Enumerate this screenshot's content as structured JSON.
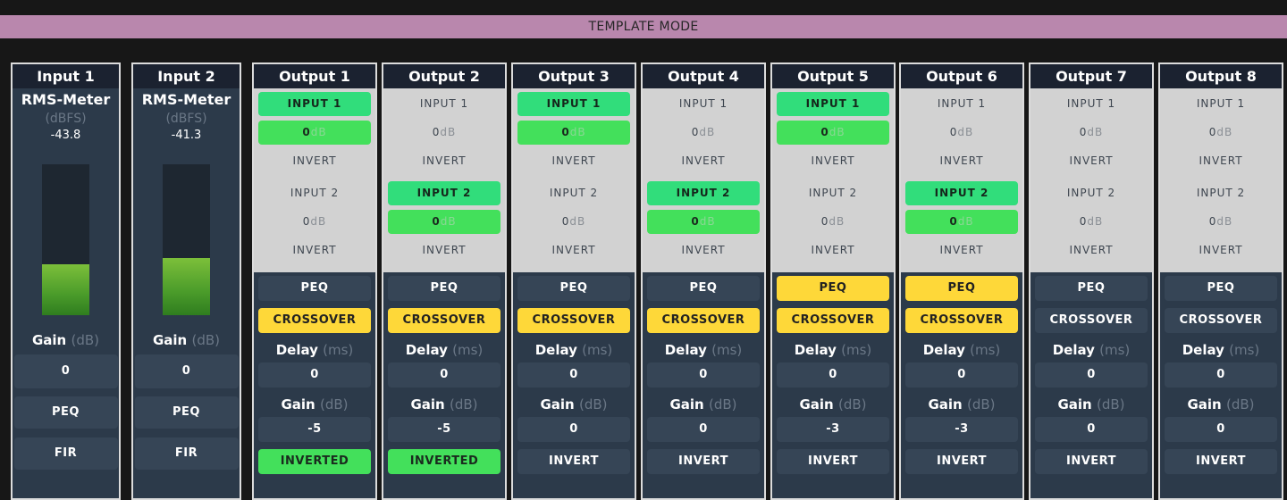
{
  "banner": "TEMPLATE MODE",
  "inputs": [
    {
      "title": "Input 1",
      "rms_label": "RMS-Meter",
      "rms_unit": "(dBFS)",
      "rms_value": "-43.8",
      "meter_level": 0.34,
      "gain_label": "Gain",
      "gain_unit": "(dB)",
      "gain_value": "0",
      "peq": "PEQ",
      "fir": "FIR"
    },
    {
      "title": "Input 2",
      "rms_label": "RMS-Meter",
      "rms_unit": "(dBFS)",
      "rms_value": "-41.3",
      "meter_level": 0.38,
      "gain_label": "Gain",
      "gain_unit": "(dB)",
      "gain_value": "0",
      "peq": "PEQ",
      "fir": "FIR"
    }
  ],
  "outputs": [
    {
      "title": "Output 1",
      "in1": "INPUT 1",
      "in1_on": true,
      "db1": "0",
      "db1_on": true,
      "inv1": "INVERT",
      "in2": "INPUT 2",
      "in2_on": false,
      "db2": "0",
      "db2_on": false,
      "inv2": "INVERT",
      "peq": "PEQ",
      "peq_on": false,
      "crossover": "CROSSOVER",
      "crossover_on": true,
      "delay_label": "Delay",
      "delay_unit": "(ms)",
      "delay_value": "0",
      "gain_label": "Gain",
      "gain_unit": "(dB)",
      "gain_value": "-5",
      "invert": "INVERTED",
      "invert_on": true
    },
    {
      "title": "Output 2",
      "in1": "INPUT 1",
      "in1_on": false,
      "db1": "0",
      "db1_on": false,
      "inv1": "INVERT",
      "in2": "INPUT 2",
      "in2_on": true,
      "db2": "0",
      "db2_on": true,
      "inv2": "INVERT",
      "peq": "PEQ",
      "peq_on": false,
      "crossover": "CROSSOVER",
      "crossover_on": true,
      "delay_label": "Delay",
      "delay_unit": "(ms)",
      "delay_value": "0",
      "gain_label": "Gain",
      "gain_unit": "(dB)",
      "gain_value": "-5",
      "invert": "INVERTED",
      "invert_on": true
    },
    {
      "title": "Output 3",
      "in1": "INPUT 1",
      "in1_on": true,
      "db1": "0",
      "db1_on": true,
      "inv1": "INVERT",
      "in2": "INPUT 2",
      "in2_on": false,
      "db2": "0",
      "db2_on": false,
      "inv2": "INVERT",
      "peq": "PEQ",
      "peq_on": false,
      "crossover": "CROSSOVER",
      "crossover_on": true,
      "delay_label": "Delay",
      "delay_unit": "(ms)",
      "delay_value": "0",
      "gain_label": "Gain",
      "gain_unit": "(dB)",
      "gain_value": "0",
      "invert": "INVERT",
      "invert_on": false
    },
    {
      "title": "Output 4",
      "in1": "INPUT 1",
      "in1_on": false,
      "db1": "0",
      "db1_on": false,
      "inv1": "INVERT",
      "in2": "INPUT 2",
      "in2_on": true,
      "db2": "0",
      "db2_on": true,
      "inv2": "INVERT",
      "peq": "PEQ",
      "peq_on": false,
      "crossover": "CROSSOVER",
      "crossover_on": true,
      "delay_label": "Delay",
      "delay_unit": "(ms)",
      "delay_value": "0",
      "gain_label": "Gain",
      "gain_unit": "(dB)",
      "gain_value": "0",
      "invert": "INVERT",
      "invert_on": false
    },
    {
      "title": "Output 5",
      "in1": "INPUT 1",
      "in1_on": true,
      "db1": "0",
      "db1_on": true,
      "inv1": "INVERT",
      "in2": "INPUT 2",
      "in2_on": false,
      "db2": "0",
      "db2_on": false,
      "inv2": "INVERT",
      "peq": "PEQ",
      "peq_on": true,
      "crossover": "CROSSOVER",
      "crossover_on": true,
      "delay_label": "Delay",
      "delay_unit": "(ms)",
      "delay_value": "0",
      "gain_label": "Gain",
      "gain_unit": "(dB)",
      "gain_value": "-3",
      "invert": "INVERT",
      "invert_on": false
    },
    {
      "title": "Output 6",
      "in1": "INPUT 1",
      "in1_on": false,
      "db1": "0",
      "db1_on": false,
      "inv1": "INVERT",
      "in2": "INPUT 2",
      "in2_on": true,
      "db2": "0",
      "db2_on": true,
      "inv2": "INVERT",
      "peq": "PEQ",
      "peq_on": true,
      "crossover": "CROSSOVER",
      "crossover_on": true,
      "delay_label": "Delay",
      "delay_unit": "(ms)",
      "delay_value": "0",
      "gain_label": "Gain",
      "gain_unit": "(dB)",
      "gain_value": "-3",
      "invert": "INVERT",
      "invert_on": false
    },
    {
      "title": "Output 7",
      "in1": "INPUT 1",
      "in1_on": false,
      "db1": "0",
      "db1_on": false,
      "inv1": "INVERT",
      "in2": "INPUT 2",
      "in2_on": false,
      "db2": "0",
      "db2_on": false,
      "inv2": "INVERT",
      "peq": "PEQ",
      "peq_on": false,
      "crossover": "CROSSOVER",
      "crossover_on": false,
      "delay_label": "Delay",
      "delay_unit": "(ms)",
      "delay_value": "0",
      "gain_label": "Gain",
      "gain_unit": "(dB)",
      "gain_value": "0",
      "invert": "INVERT",
      "invert_on": false
    },
    {
      "title": "Output 8",
      "in1": "INPUT 1",
      "in1_on": false,
      "db1": "0",
      "db1_on": false,
      "inv1": "INVERT",
      "in2": "INPUT 2",
      "in2_on": false,
      "db2": "0",
      "db2_on": false,
      "inv2": "INVERT",
      "peq": "PEQ",
      "peq_on": false,
      "crossover": "CROSSOVER",
      "crossover_on": false,
      "delay_label": "Delay",
      "delay_unit": "(ms)",
      "delay_value": "0",
      "gain_label": "Gain",
      "gain_unit": "(dB)",
      "gain_value": "0",
      "invert": "INVERT",
      "invert_on": false
    }
  ],
  "db_unit": "dB",
  "colors": {
    "banner": "#b987ad",
    "active_green": "#43e05b",
    "active_teal": "#31dd7b",
    "active_yellow": "#fed839",
    "panel": "#2c3a4a",
    "routing_bg": "#d2d2d2"
  }
}
